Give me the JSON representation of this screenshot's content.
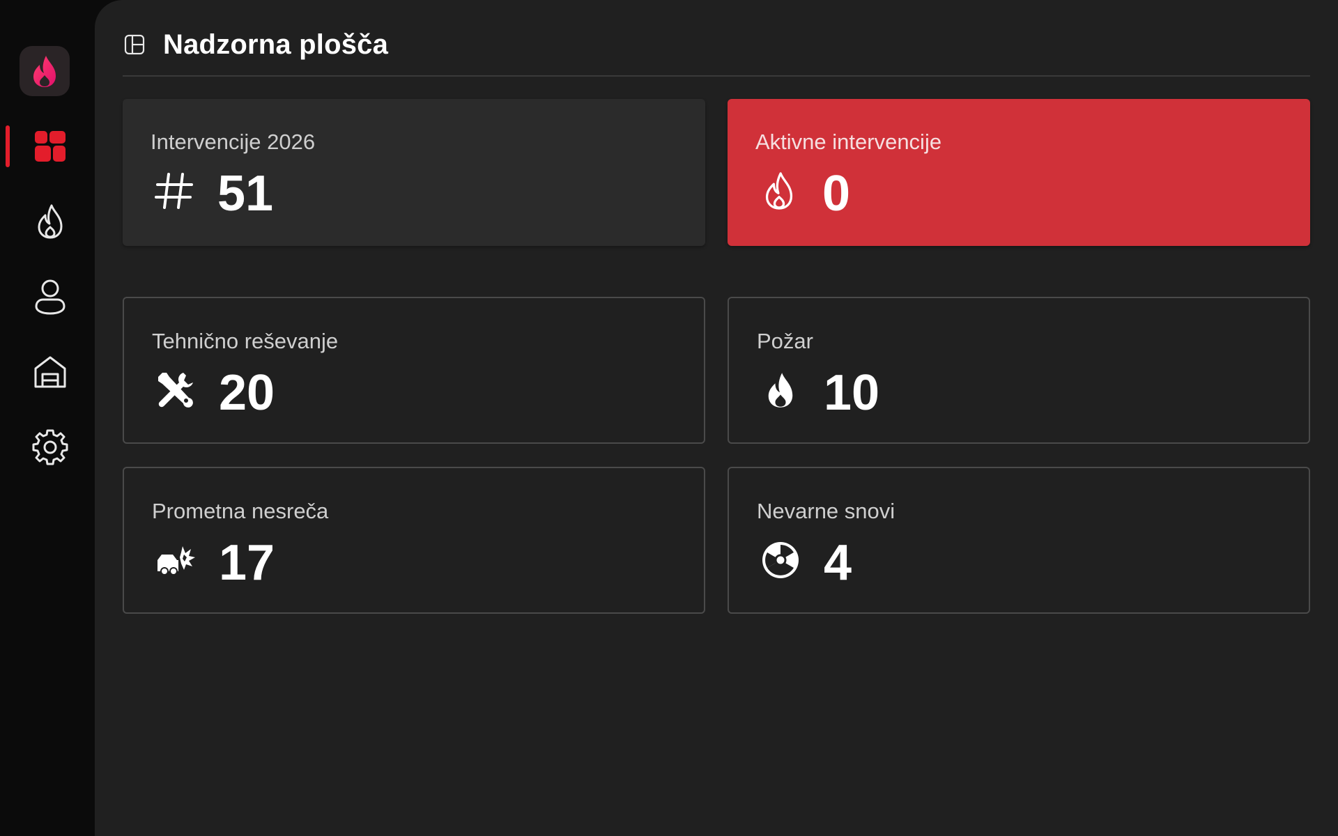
{
  "app": {
    "brand_color": "#e31d2b",
    "logo_icon": "flame-logo-icon"
  },
  "sidebar": {
    "items": [
      {
        "id": "dashboard",
        "icon": "dashboard-icon",
        "active": true
      },
      {
        "id": "interventions",
        "icon": "flame-icon",
        "active": false
      },
      {
        "id": "members",
        "icon": "person-icon",
        "active": false
      },
      {
        "id": "stations",
        "icon": "garage-icon",
        "active": false
      },
      {
        "id": "settings",
        "icon": "gear-icon",
        "active": false
      }
    ]
  },
  "header": {
    "title": "Nadzorna plošča",
    "icon": "board-icon"
  },
  "stats": {
    "total": {
      "label": "Intervencije 2026",
      "value": "51",
      "icon": "hash-icon"
    },
    "active": {
      "label": "Aktivne intervencije",
      "value": "0",
      "icon": "flame-outline-icon",
      "color": "#d03139"
    },
    "technical": {
      "label": "Tehnično reševanje",
      "value": "20",
      "icon": "wrench-screwdriver-icon"
    },
    "fire": {
      "label": "Požar",
      "value": "10",
      "icon": "fire-icon"
    },
    "traffic": {
      "label": "Prometna nesreča",
      "value": "17",
      "icon": "car-crash-icon"
    },
    "hazmat": {
      "label": "Nevarne snovi",
      "value": "4",
      "icon": "radiation-icon"
    }
  }
}
